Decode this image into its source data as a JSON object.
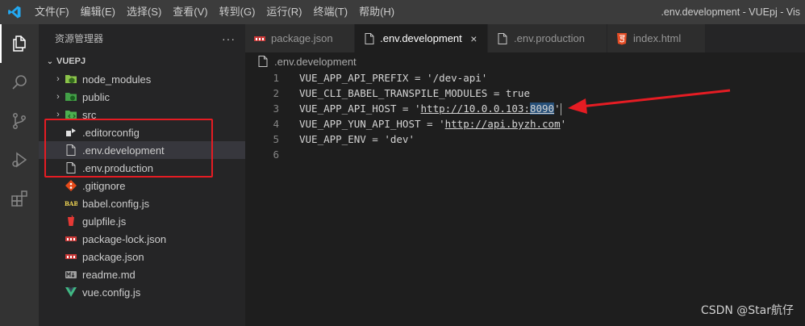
{
  "titlebar": {
    "menu": [
      "文件(F)",
      "编辑(E)",
      "选择(S)",
      "查看(V)",
      "转到(G)",
      "运行(R)",
      "终端(T)",
      "帮助(H)"
    ],
    "window_title": ".env.development - VUEpj - Vis"
  },
  "activitybar": {
    "items": [
      "files-icon",
      "search-icon",
      "source-control-icon",
      "run-debug-icon",
      "extensions-icon"
    ]
  },
  "sidebar": {
    "title": "资源管理器",
    "more": "···",
    "folder": "VUEPJ",
    "items": [
      {
        "label": "node_modules",
        "type": "folder",
        "icon": "node-folder-icon"
      },
      {
        "label": "public",
        "type": "folder",
        "icon": "public-folder-icon"
      },
      {
        "label": "src",
        "type": "folder",
        "icon": "src-folder-icon"
      },
      {
        "label": ".editorconfig",
        "type": "file",
        "icon": "editorconfig-icon"
      },
      {
        "label": ".env.development",
        "type": "file",
        "icon": "file-icon",
        "selected": true
      },
      {
        "label": ".env.production",
        "type": "file",
        "icon": "file-icon"
      },
      {
        "label": ".gitignore",
        "type": "file",
        "icon": "git-icon"
      },
      {
        "label": "babel.config.js",
        "type": "file",
        "icon": "babel-icon"
      },
      {
        "label": "gulpfile.js",
        "type": "file",
        "icon": "gulp-icon"
      },
      {
        "label": "package-lock.json",
        "type": "file",
        "icon": "npm-icon"
      },
      {
        "label": "package.json",
        "type": "file",
        "icon": "npm-icon"
      },
      {
        "label": "readme.md",
        "type": "file",
        "icon": "markdown-icon"
      },
      {
        "label": "vue.config.js",
        "type": "file",
        "icon": "vue-icon"
      }
    ]
  },
  "tabs": [
    {
      "label": "package.json",
      "icon": "npm-icon",
      "active": false
    },
    {
      "label": ".env.development",
      "icon": "file-icon",
      "active": true,
      "close": "×"
    },
    {
      "label": ".env.production",
      "icon": "file-icon",
      "active": false
    },
    {
      "label": "index.html",
      "icon": "html5-icon",
      "active": false
    }
  ],
  "breadcrumb": ".env.development",
  "editor": {
    "lines": [
      {
        "n": "1",
        "pre": "VUE_APP_API_PREFIX = '/dev-api'",
        "url": "",
        "post": ""
      },
      {
        "n": "2",
        "pre": "VUE_CLI_BABEL_TRANSPILE_MODULES = true",
        "url": "",
        "post": ""
      },
      {
        "n": "3",
        "pre": "VUE_APP_API_HOST = '",
        "url": "http://10.0.0.103:",
        "sel": "8090",
        "post": "'"
      },
      {
        "n": "4",
        "pre": "VUE_APP_YUN_API_HOST = '",
        "url": "http://api.byzh.com",
        "post": "'"
      },
      {
        "n": "5",
        "pre": "VUE_APP_ENV = 'dev'",
        "url": "",
        "post": ""
      },
      {
        "n": "6",
        "pre": "",
        "url": "",
        "post": ""
      }
    ]
  },
  "watermark": "CSDN @Star航仔",
  "colors": {
    "annotation_red": "#e51c23",
    "vscode_blue": "#23a9f2"
  }
}
